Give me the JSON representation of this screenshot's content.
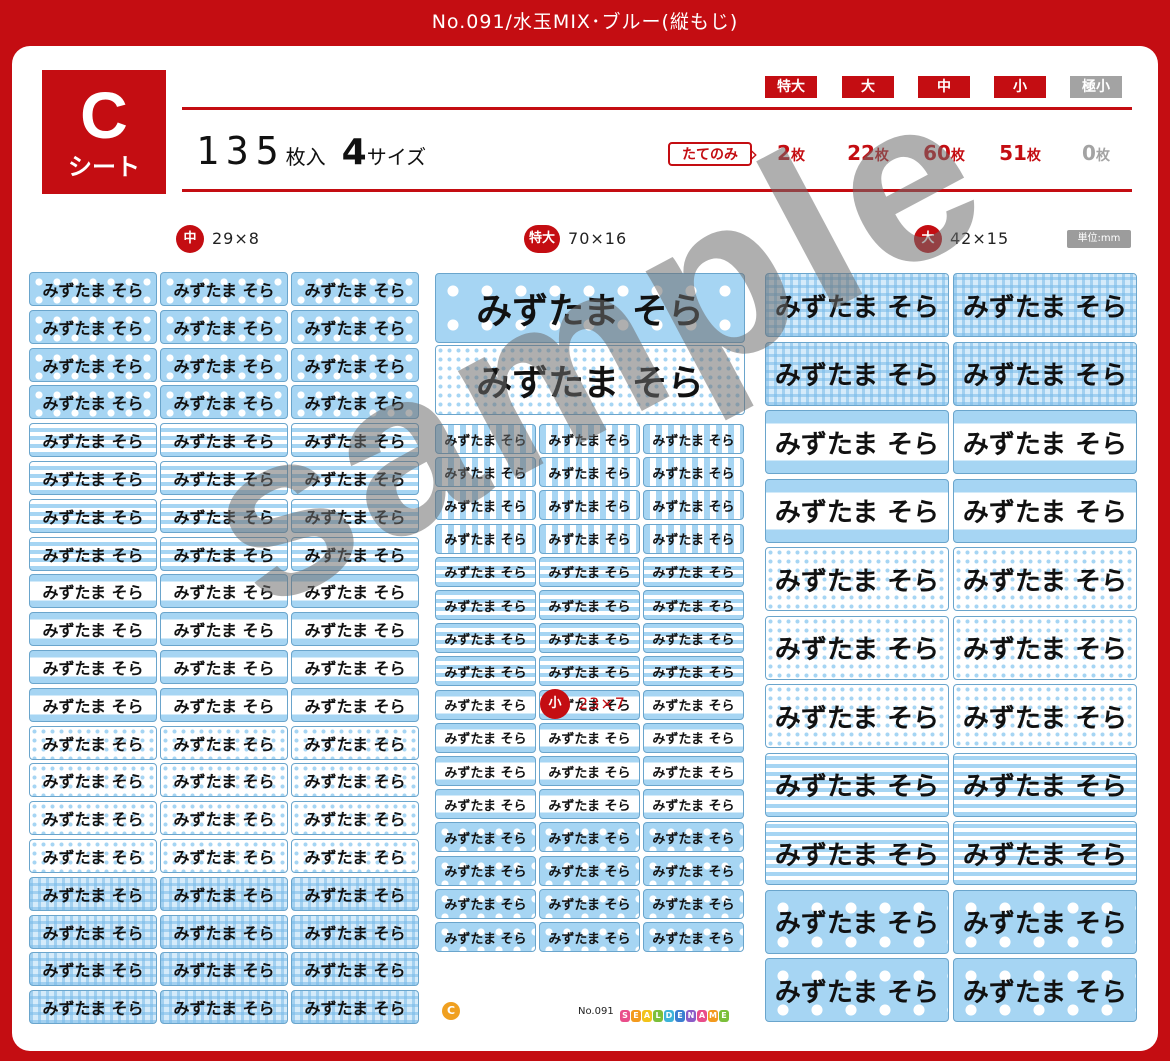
{
  "header": {
    "title": "No.091/水玉MIX･ブルー(縦もじ)"
  },
  "sheet_badge": {
    "letter": "C",
    "word": "シート"
  },
  "summary": {
    "count": "135",
    "count_unit": "枚入",
    "sizes": "4",
    "sizes_unit": "サイズ"
  },
  "size_tabs": [
    {
      "label": "特大",
      "active": true
    },
    {
      "label": "大",
      "active": true
    },
    {
      "label": "中",
      "active": true
    },
    {
      "label": "小",
      "active": true
    },
    {
      "label": "極小",
      "active": false
    }
  ],
  "orientation": {
    "label": "たてのみ"
  },
  "counts": [
    {
      "value": "2",
      "unit": "枚"
    },
    {
      "value": "22",
      "unit": "枚"
    },
    {
      "value": "60",
      "unit": "枚"
    },
    {
      "value": "51",
      "unit": "枚"
    },
    {
      "value": "0",
      "unit": "枚"
    }
  ],
  "columns": [
    {
      "badge": "中",
      "dims": "29×8"
    },
    {
      "badge": "特大",
      "dims": "70×16"
    },
    {
      "badge": "大",
      "dims": "42×15"
    }
  ],
  "unit_note": "単位:mm",
  "sample_name": "みずたま そら",
  "small_tag": {
    "badge": "小",
    "dims": "23×7"
  },
  "watermark": "sample",
  "footer": {
    "sheet": "C",
    "number": "No.091",
    "brand": "SEALDENAME"
  },
  "colors": {
    "brand_red": "#c40d12",
    "pattern_blue": "#a6d5f3",
    "inactive_gray": "#a3a3a3"
  }
}
